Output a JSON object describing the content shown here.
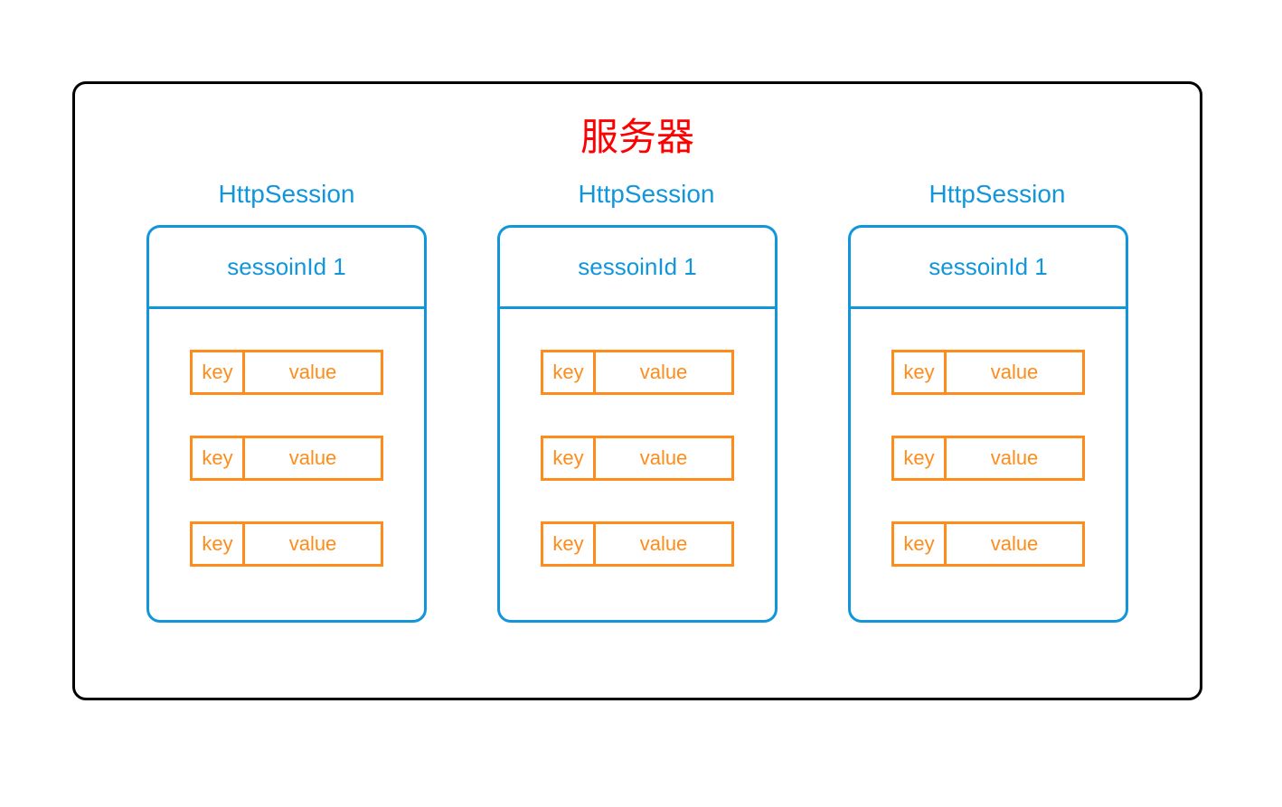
{
  "server": {
    "title": "服务器",
    "sessions": [
      {
        "label": "HttpSession",
        "id_label": "sessoinId 1",
        "pairs": [
          {
            "key": "key",
            "value": "value"
          },
          {
            "key": "key",
            "value": "value"
          },
          {
            "key": "key",
            "value": "value"
          }
        ]
      },
      {
        "label": "HttpSession",
        "id_label": "sessoinId 1",
        "pairs": [
          {
            "key": "key",
            "value": "value"
          },
          {
            "key": "key",
            "value": "value"
          },
          {
            "key": "key",
            "value": "value"
          }
        ]
      },
      {
        "label": "HttpSession",
        "id_label": "sessoinId 1",
        "pairs": [
          {
            "key": "key",
            "value": "value"
          },
          {
            "key": "key",
            "value": "value"
          },
          {
            "key": "key",
            "value": "value"
          }
        ]
      }
    ]
  }
}
